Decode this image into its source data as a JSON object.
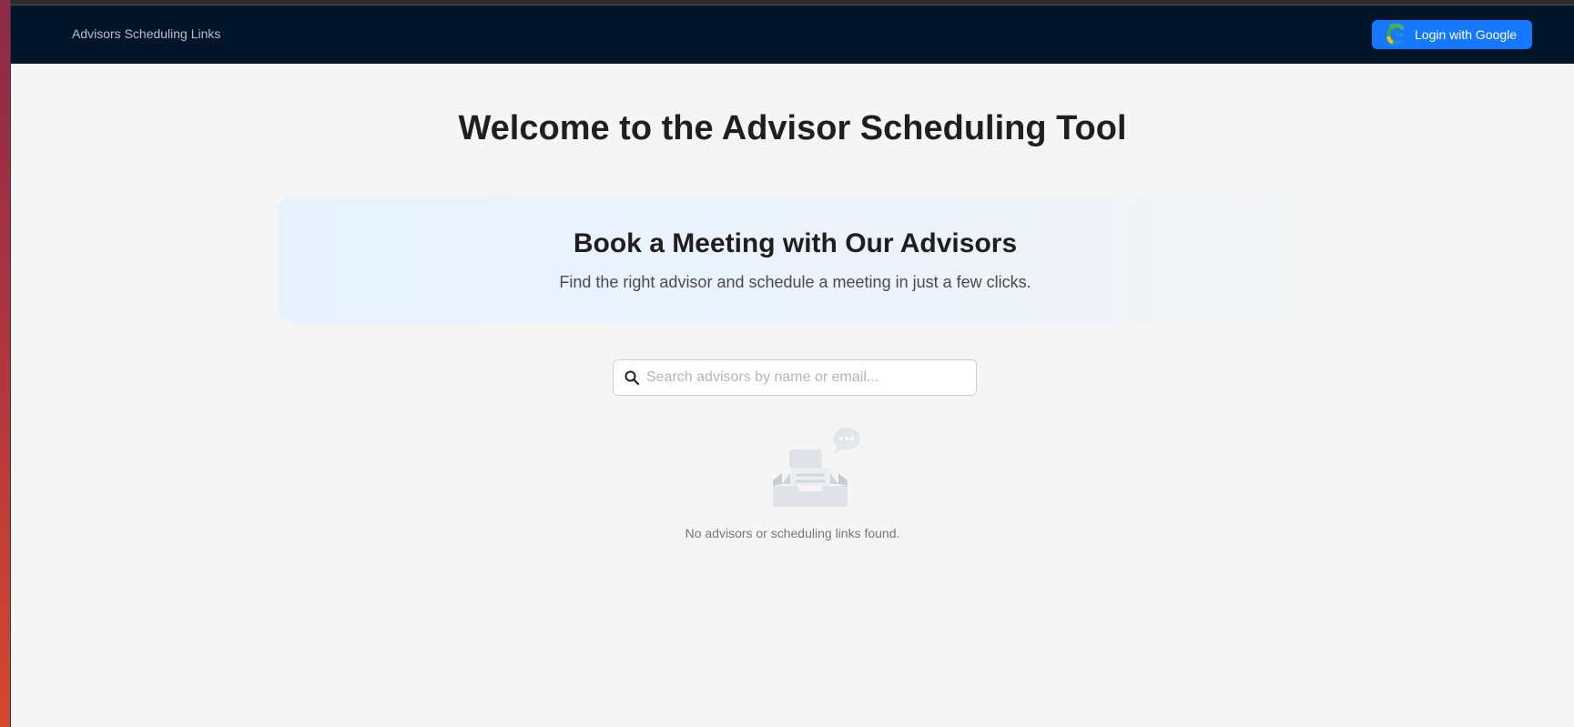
{
  "navbar": {
    "brand": "Advisors Scheduling Links",
    "login_label": "Login with Google",
    "login_icon": "google-g-icon"
  },
  "main": {
    "title": "Welcome to the Advisor Scheduling Tool",
    "hero": {
      "title": "Book a Meeting with Our Advisors",
      "subtitle": "Find the right advisor and schedule a meeting in just a few clicks."
    },
    "search": {
      "placeholder": "Search advisors by name or email...",
      "value": "",
      "icon": "search-icon"
    },
    "empty_state": {
      "icon": "empty-inbox-icon",
      "message": "No advisors or scheduling links found."
    }
  },
  "colors": {
    "navbar_bg": "#001529",
    "primary": "#1677ff",
    "page_bg": "#f5f5f5"
  }
}
